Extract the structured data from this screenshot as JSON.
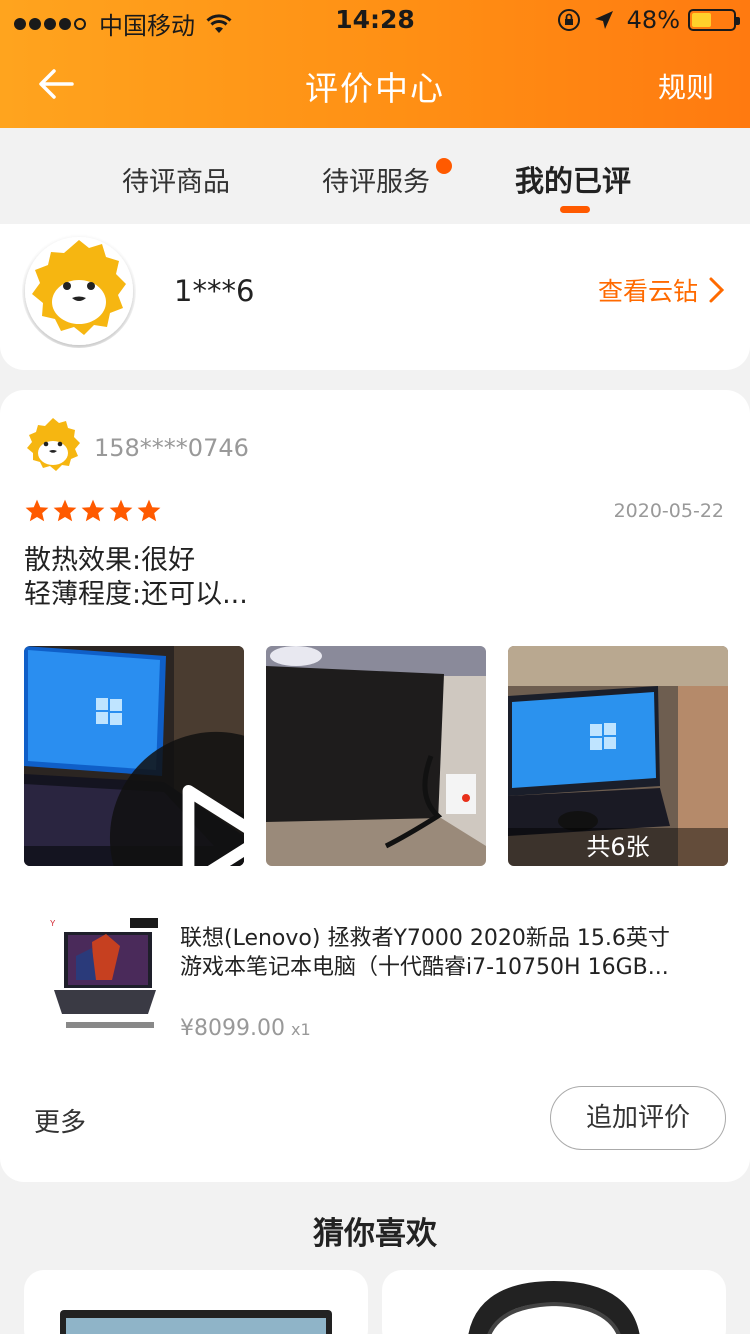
{
  "status_bar": {
    "carrier": "中国移动",
    "time": "14:28",
    "battery": "48%",
    "battery_level": 0.48
  },
  "header": {
    "title": "评价中心",
    "rules": "规则",
    "back_icon": "back-arrow-icon",
    "colors": {
      "start": "#ffa41e",
      "end": "#ff7a10"
    }
  },
  "tabs": [
    {
      "label": "待评商品",
      "active": false
    },
    {
      "label": "待评服务",
      "active": false,
      "badge_dot": true
    },
    {
      "label": "我的已评",
      "active": true
    }
  ],
  "user": {
    "name": "1***6",
    "link": "查看云钻"
  },
  "review": {
    "reviewer": "158****0746",
    "rating": 5,
    "date": "2020-05-22",
    "lines": [
      "散热效果:很好",
      "轻薄程度:还可以..."
    ],
    "photo_count": "共6张",
    "product": {
      "title_line1": "联想(Lenovo) 拯救者Y7000 2020新品 15.6英寸",
      "title_line2": "游戏本笔记本电脑（十代酷睿i7-10750H 16GB...",
      "price": "¥8099.00",
      "qty": "x1"
    },
    "more": "更多",
    "append": "追加评价"
  },
  "recommend": {
    "title": "猜你喜欢"
  },
  "accent": "#ff5a00"
}
